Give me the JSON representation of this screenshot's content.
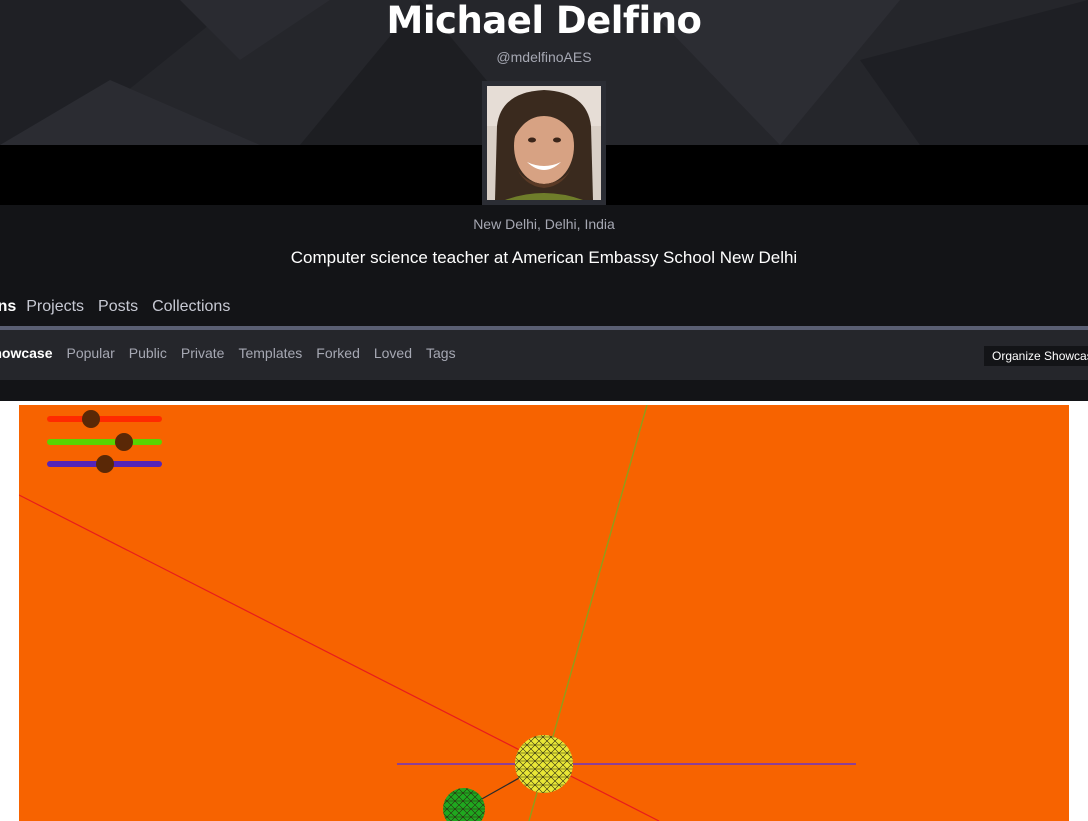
{
  "profile": {
    "name": "Michael Delfino",
    "handle": "@mdelfinoAES",
    "location": "New Delhi, Delhi, India",
    "bio": "Computer science teacher at American Embassy School New Delhi",
    "avatar_icon": "profile-photo"
  },
  "primary_tabs": [
    {
      "label": "Pens",
      "active": true
    },
    {
      "label": "Projects",
      "active": false
    },
    {
      "label": "Posts",
      "active": false
    },
    {
      "label": "Collections",
      "active": false
    }
  ],
  "sub_tabs": [
    {
      "label": "Showcase",
      "active": true
    },
    {
      "label": "Popular",
      "active": false
    },
    {
      "label": "Public",
      "active": false
    },
    {
      "label": "Private",
      "active": false
    },
    {
      "label": "Templates",
      "active": false
    },
    {
      "label": "Forked",
      "active": false
    },
    {
      "label": "Loved",
      "active": false
    },
    {
      "label": "Tags",
      "active": false
    }
  ],
  "organize_button": "Organize Showcase",
  "pen_preview": {
    "background_color": "#f76300",
    "sliders": [
      {
        "name": "red",
        "color": "#ff2a00",
        "value": 0.38
      },
      {
        "name": "green",
        "color": "#5ad400",
        "value": 0.68
      },
      {
        "name": "blue",
        "color": "#5524b8",
        "value": 0.5
      }
    ],
    "knob_color": "#5a2806",
    "axis_colors": {
      "x": "#6a35c8",
      "y": "#8f9e1a",
      "z": "#e81c1c"
    },
    "spheres": [
      {
        "name": "sun",
        "color": "#e8e636",
        "icon": "wireframe-sphere"
      },
      {
        "name": "planet",
        "color": "#1fa81f",
        "icon": "wireframe-sphere"
      }
    ]
  }
}
